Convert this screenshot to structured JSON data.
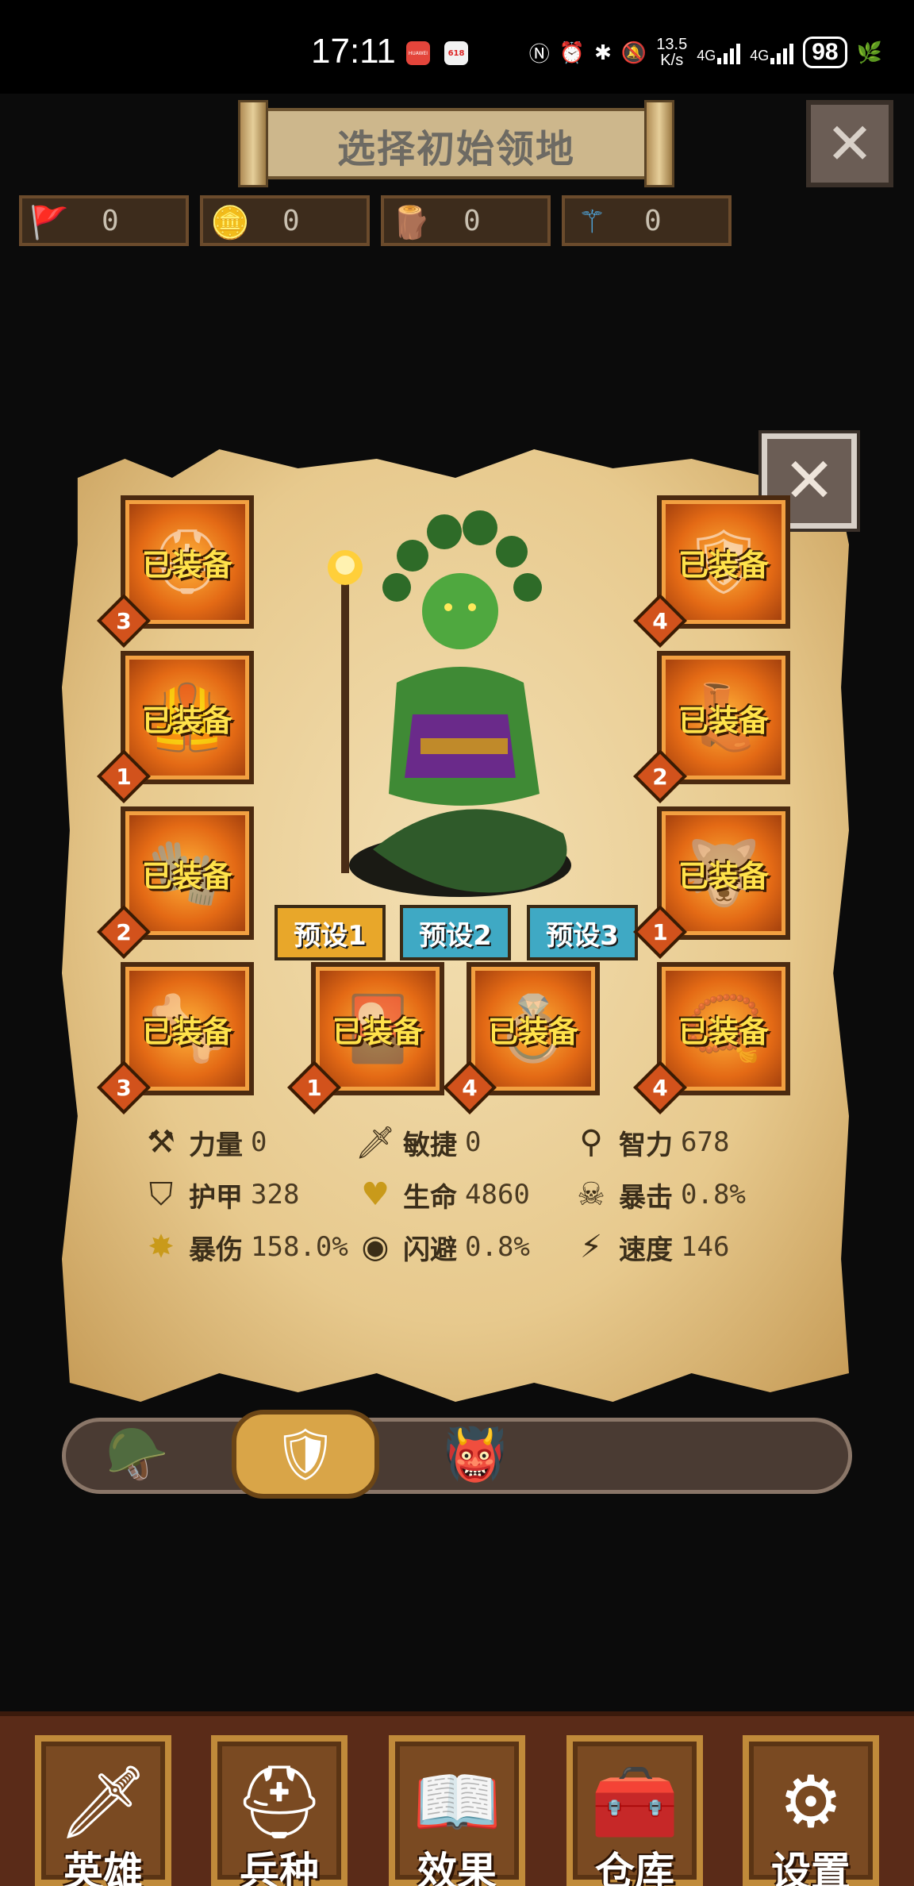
{
  "status_bar": {
    "time": "17:11",
    "net_speed_value": "13.5",
    "net_speed_unit": "K/s",
    "net1": "4G",
    "net2": "4G",
    "battery": "98",
    "app_badge_1": "HUAWEI",
    "app_badge_2": "618"
  },
  "header": {
    "title": "选择初始领地",
    "close_icon": "close-icon"
  },
  "resources": [
    {
      "icon": "banner-person-icon",
      "value": "0"
    },
    {
      "icon": "gold-coins-icon",
      "value": "0"
    },
    {
      "icon": "wood-logs-icon",
      "value": "0"
    },
    {
      "icon": "magic-staff-icon",
      "value": "0"
    }
  ],
  "equipment": {
    "equipped_label": "已装备",
    "slots": [
      {
        "name": "helmet",
        "level": "3",
        "icon": "helmet-icon"
      },
      {
        "name": "armor",
        "level": "1",
        "icon": "armor-icon"
      },
      {
        "name": "gauntlet",
        "level": "2",
        "icon": "gauntlet-icon"
      },
      {
        "name": "weapon",
        "level": "3",
        "icon": "horned-staff-icon"
      },
      {
        "name": "shield",
        "level": "4",
        "icon": "shield-icon"
      },
      {
        "name": "boots",
        "level": "2",
        "icon": "boots-icon"
      },
      {
        "name": "mount",
        "level": "1",
        "icon": "beast-mount-icon"
      },
      {
        "name": "amulet",
        "level": "4",
        "icon": "amulet-icon"
      },
      {
        "name": "card",
        "level": "1",
        "icon": "spell-card-icon"
      },
      {
        "name": "ring",
        "level": "4",
        "icon": "gem-ring-icon"
      }
    ]
  },
  "presets": [
    {
      "label": "预设1",
      "active": true
    },
    {
      "label": "预设2",
      "active": false
    },
    {
      "label": "预设3",
      "active": false
    }
  ],
  "stats": [
    {
      "label": "力量",
      "value": "0",
      "icon": "axe-icon"
    },
    {
      "label": "敏捷",
      "value": "0",
      "icon": "sword-icon"
    },
    {
      "label": "智力",
      "value": "678",
      "icon": "wand-icon"
    },
    {
      "label": "护甲",
      "value": "328",
      "icon": "shield-icon"
    },
    {
      "label": "生命",
      "value": "4860",
      "icon": "heart-icon"
    },
    {
      "label": "暴击",
      "value": "0.8%",
      "icon": "skull-icon"
    },
    {
      "label": "暴伤",
      "value": "158.0%",
      "icon": "burst-icon"
    },
    {
      "label": "闪避",
      "value": "0.8%",
      "icon": "eye-icon"
    },
    {
      "label": "速度",
      "value": "146",
      "icon": "lightning-icon"
    }
  ],
  "hero_tabs": [
    {
      "icon": "knight-helmet-icon",
      "active": false
    },
    {
      "icon": "crest-shield-icon",
      "active": true
    },
    {
      "icon": "orc-warrior-icon",
      "active": false
    }
  ],
  "nav": [
    {
      "label": "英雄",
      "icon": "sword-icon"
    },
    {
      "label": "兵种",
      "icon": "spartan-helmet-icon"
    },
    {
      "label": "效果",
      "icon": "spellbook-icon"
    },
    {
      "label": "仓库",
      "icon": "treasure-chest-icon"
    },
    {
      "label": "设置",
      "icon": "gear-icon"
    }
  ],
  "colors": {
    "preset_active": "#e8a72a",
    "preset_inactive": "#3fa9c4",
    "equip_text": "#ffe24a",
    "badge": "#d2521c"
  }
}
